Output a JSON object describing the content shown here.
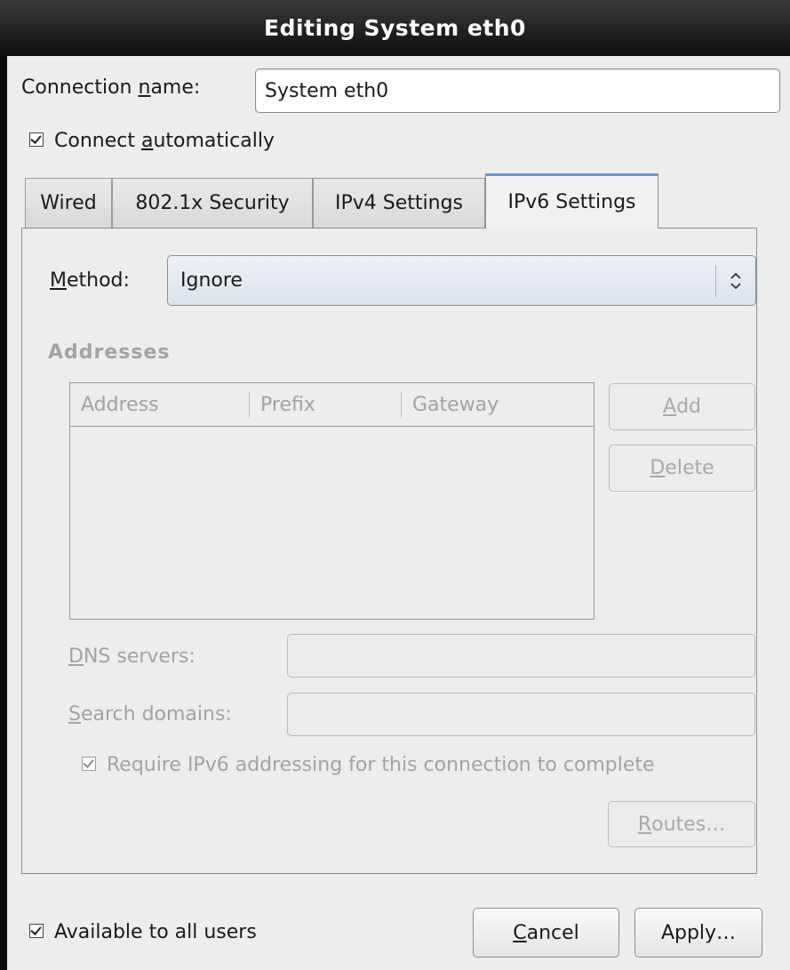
{
  "window": {
    "title": "Editing System eth0"
  },
  "connection": {
    "name_label_pre": "Connection ",
    "name_label_mn": "n",
    "name_label_post": "ame:",
    "name_value": "System eth0"
  },
  "connect_auto": {
    "label_pre": "Connect ",
    "label_mn": "a",
    "label_post": "utomatically",
    "checked": true
  },
  "tabs": [
    {
      "label": "Wired"
    },
    {
      "label": "802.1x Security"
    },
    {
      "label": "IPv4 Settings"
    },
    {
      "label": "IPv6 Settings",
      "active": true
    }
  ],
  "method": {
    "label_mn": "M",
    "label_post": "ethod:",
    "value": "Ignore"
  },
  "addresses": {
    "heading": "Addresses",
    "columns": [
      "Address",
      "Prefix",
      "Gateway"
    ],
    "rows": [],
    "add_mn": "A",
    "add_post": "dd",
    "delete_mn": "D",
    "delete_post": "elete"
  },
  "dns": {
    "label_mn": "D",
    "label_post": "NS servers:",
    "value": ""
  },
  "search": {
    "label_mn": "S",
    "label_post": "earch domains:",
    "value": ""
  },
  "require_ipv6": {
    "label": "Require IPv6 addressing for this connection to complete",
    "checked": true
  },
  "routes": {
    "mn": "R",
    "post": "outes…"
  },
  "available_all": {
    "label": "Available to all users",
    "checked": true
  },
  "cancel": {
    "mn": "C",
    "post": "ancel"
  },
  "apply": {
    "label": "Apply…"
  },
  "icons": {
    "combo_arrows": "up-down-chevron-icon",
    "check": "checkmark-icon"
  }
}
